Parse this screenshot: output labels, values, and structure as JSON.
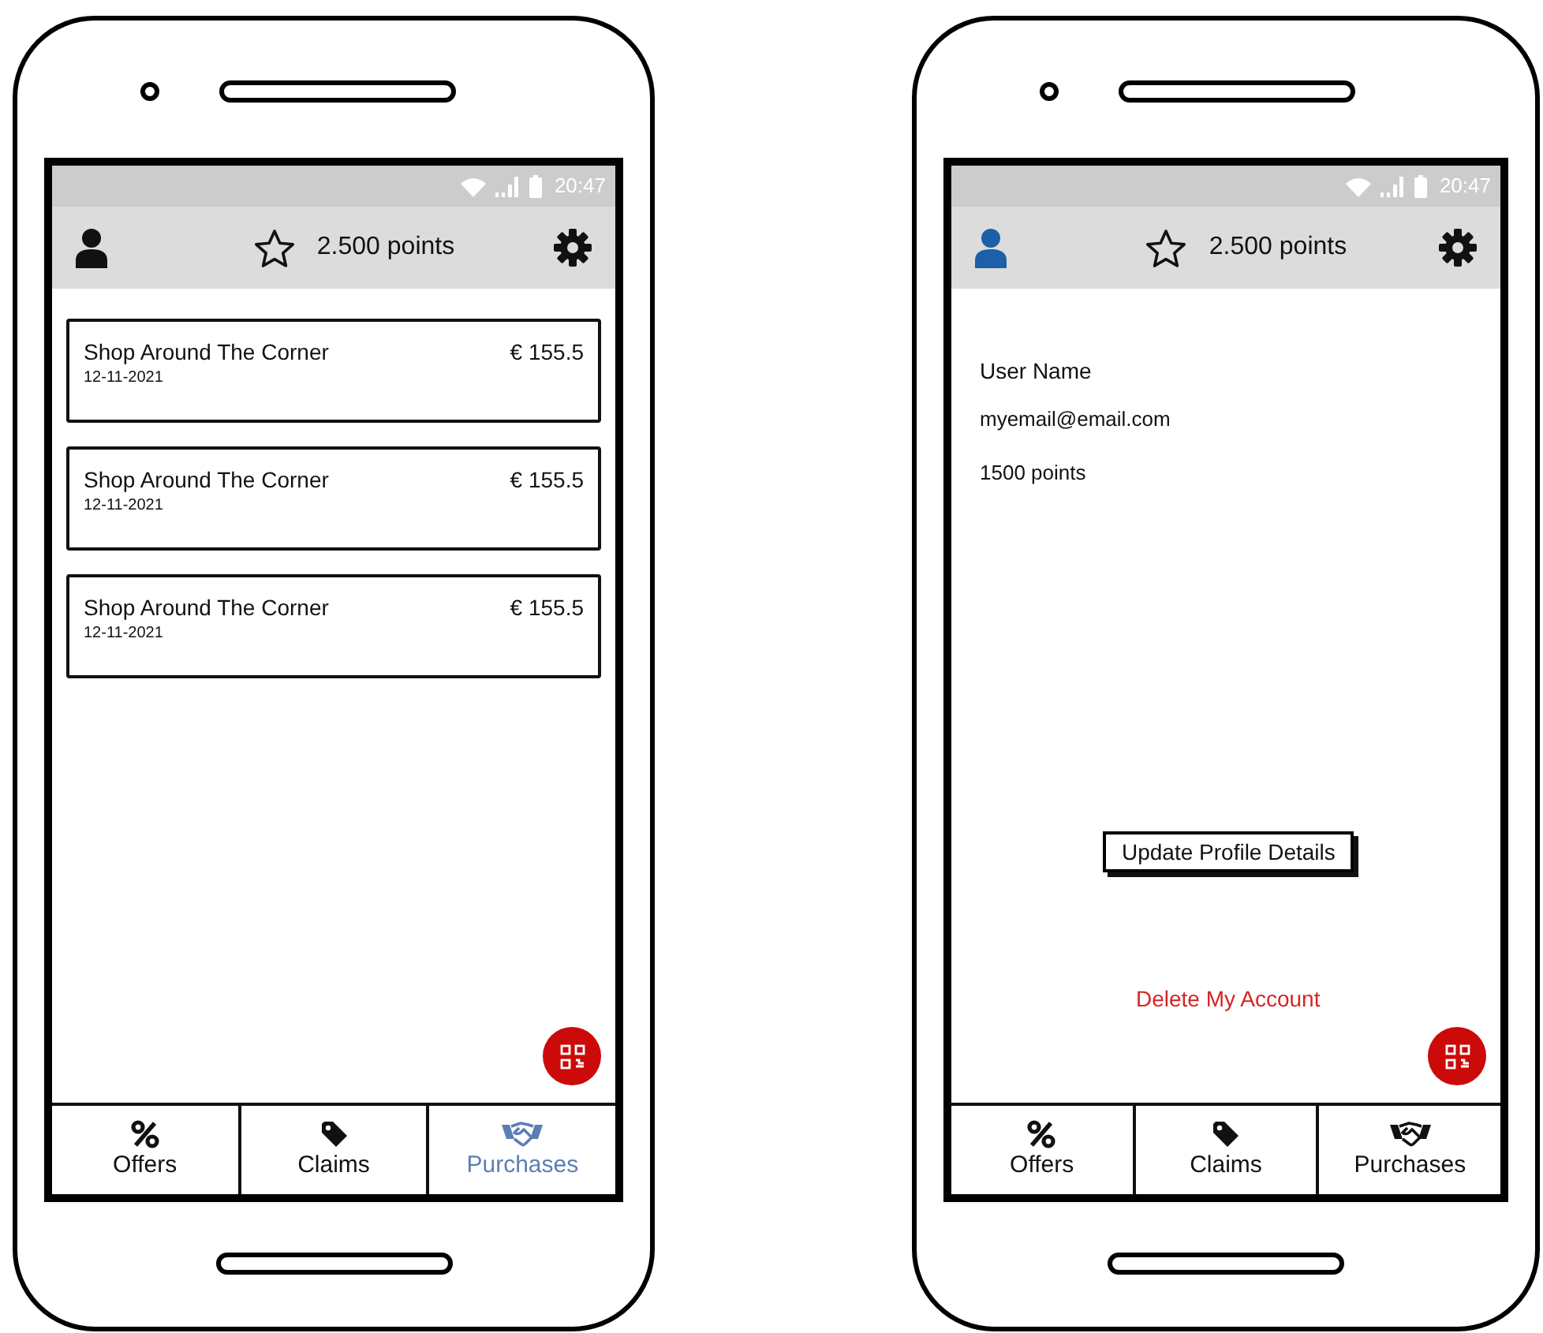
{
  "phones": [
    {
      "status_bar": {
        "time": "20:47"
      },
      "header": {
        "profile_active": false,
        "points": "2.500 points"
      },
      "content": {
        "kind": "purchases",
        "purchases": [
          {
            "shop": "Shop Around The Corner",
            "date": "12-11-2021",
            "amount": "€ 155.5"
          },
          {
            "shop": "Shop Around The Corner",
            "date": "12-11-2021",
            "amount": "€ 155.5"
          },
          {
            "shop": "Shop Around The Corner",
            "date": "12-11-2021",
            "amount": "€ 155.5"
          }
        ]
      },
      "tabs": [
        {
          "kind": "offers",
          "label": "Offers",
          "selected": false
        },
        {
          "kind": "claims",
          "label": "Claims",
          "selected": false
        },
        {
          "kind": "purchases",
          "label": "Purchases",
          "selected": true
        }
      ]
    },
    {
      "status_bar": {
        "time": "20:47"
      },
      "header": {
        "profile_active": true,
        "points": "2.500 points"
      },
      "content": {
        "kind": "profile",
        "user_name": "User Name",
        "email": "myemail@email.com",
        "points": "1500 points",
        "update_button": "Update Profile Details",
        "delete_link": "Delete My Account"
      },
      "tabs": [
        {
          "kind": "offers",
          "label": "Offers",
          "selected": false
        },
        {
          "kind": "claims",
          "label": "Claims",
          "selected": false
        },
        {
          "kind": "purchases",
          "label": "Purchases",
          "selected": false
        }
      ]
    }
  ]
}
